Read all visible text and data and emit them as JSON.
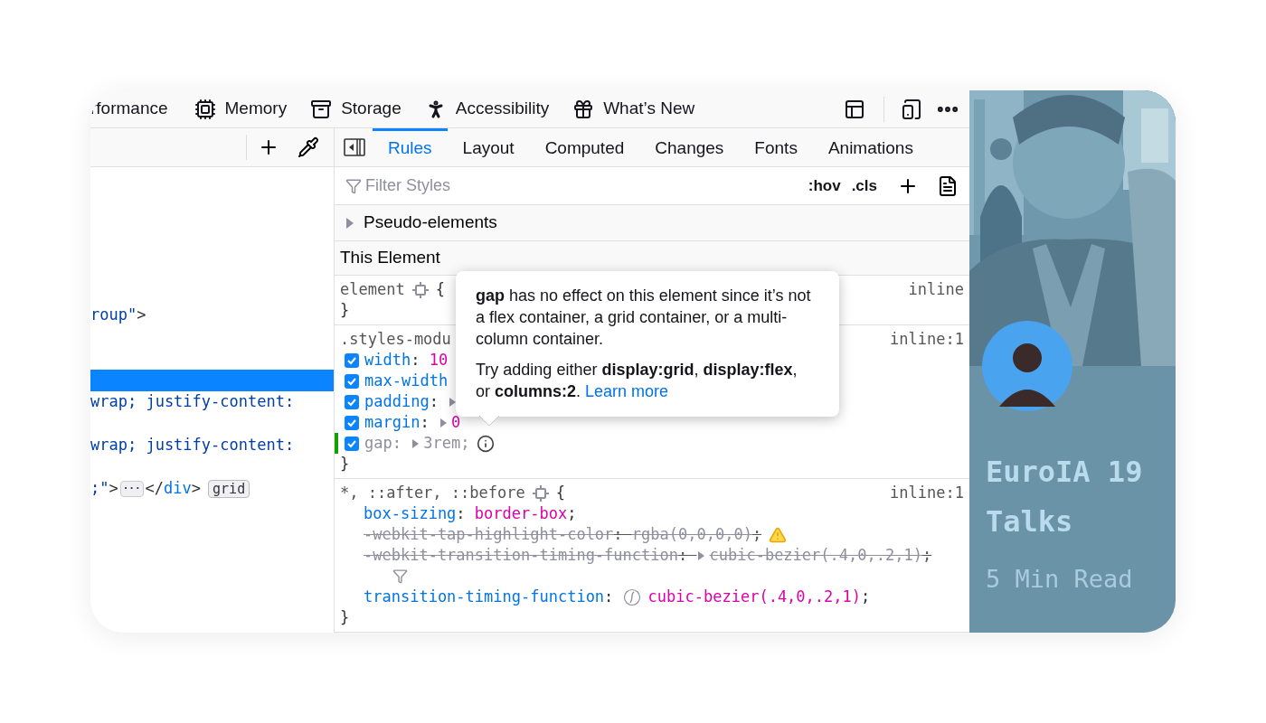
{
  "toolbar": {
    "tools": [
      {
        "label": "rformance"
      },
      {
        "label": "Memory"
      },
      {
        "label": "Storage"
      },
      {
        "label": "Accessibility"
      },
      {
        "label": "What’s New"
      }
    ]
  },
  "markup": {
    "lines": [
      {
        "selected": false
      },
      {
        "selected": false
      },
      {
        "selected": false
      },
      {
        "selected": false
      },
      {
        "selected": false
      },
      {
        "selected": false
      },
      {
        "selected": false,
        "segments": [
          {
            "text": "roup\"",
            "kind": "value"
          },
          {
            "text": ">",
            "kind": "punct"
          }
        ]
      },
      {
        "selected": false
      },
      {
        "selected": false
      },
      {
        "selected": true
      },
      {
        "selected": false,
        "segments": [
          {
            "text": "wrap; justify-content:",
            "kind": "value"
          }
        ]
      },
      {
        "selected": false
      },
      {
        "selected": false,
        "segments": [
          {
            "text": "wrap; justify-content:",
            "kind": "value"
          }
        ]
      },
      {
        "selected": false
      },
      {
        "selected": false,
        "segments": [
          {
            "text": ";\"",
            "kind": "value"
          },
          {
            "text": ">",
            "kind": "punct"
          },
          {
            "text": "···",
            "kind": "ellipsis"
          },
          {
            "text": "</",
            "kind": "punct"
          },
          {
            "text": "div",
            "kind": "tag"
          },
          {
            "text": ">",
            "kind": "punct"
          },
          {
            "text": "grid",
            "kind": "badge"
          }
        ]
      }
    ]
  },
  "rules_panel": {
    "tabs": [
      {
        "label": "Rules",
        "selected": true
      },
      {
        "label": "Layout",
        "selected": false
      },
      {
        "label": "Computed",
        "selected": false
      },
      {
        "label": "Changes",
        "selected": false
      },
      {
        "label": "Fonts",
        "selected": false
      },
      {
        "label": "Animations",
        "selected": false
      }
    ],
    "filter": {
      "placeholder": "Filter Styles"
    },
    "filter_buttons": [
      ":hov",
      ".cls"
    ],
    "pseudo_elements": {
      "label": "Pseudo-elements",
      "expanded": false
    },
    "section_title": "This Element",
    "rules": [
      {
        "selector": "element",
        "highlighter": true,
        "open": "{",
        "close": "}",
        "source": "inline"
      },
      {
        "selector": ".styles-modu",
        "highlighter": false,
        "close": "}",
        "source": "inline:1",
        "decls": [
          {
            "checked": true,
            "segments": [
              {
                "text": "width",
                "kind": "prop"
              },
              {
                "text": ": ",
                "kind": "punct"
              },
              {
                "text": "10",
                "kind": "value"
              }
            ]
          },
          {
            "checked": true,
            "segments": [
              {
                "text": "max-width",
                "kind": "prop"
              }
            ]
          },
          {
            "checked": true,
            "segments": [
              {
                "text": "padding",
                "kind": "prop"
              },
              {
                "text": ": ",
                "kind": "punct"
              },
              {
                "kind": "expander"
              }
            ]
          },
          {
            "checked": true,
            "segments": [
              {
                "text": "margin",
                "kind": "prop"
              },
              {
                "text": ": ",
                "kind": "punct"
              },
              {
                "kind": "expander"
              },
              {
                "text": "0",
                "kind": "value"
              }
            ]
          },
          {
            "checked": true,
            "changed": true,
            "segments": [
              {
                "text": "gap",
                "kind": "inactive"
              },
              {
                "text": ": ",
                "kind": "inactive"
              },
              {
                "kind": "expander"
              },
              {
                "text": "3rem;",
                "kind": "inactive"
              },
              {
                "kind": "info"
              }
            ]
          }
        ]
      },
      {
        "selector": "*, ::after, ::before",
        "highlighter": true,
        "open": "{",
        "close": "}",
        "source": "inline:1",
        "decls": [
          {
            "overridden": false,
            "segments": [
              {
                "text": "box-sizing",
                "kind": "prop"
              },
              {
                "text": ": ",
                "kind": "punct"
              },
              {
                "text": "border-box",
                "kind": "value"
              },
              {
                "text": ";",
                "kind": "punct"
              }
            ]
          },
          {
            "overridden": true,
            "segments": [
              {
                "text": "-webkit-tap-highlight-color",
                "kind": "prop"
              },
              {
                "text": ": ",
                "kind": "punct"
              },
              {
                "text": "rgba(0,0,0,0)",
                "kind": "value"
              },
              {
                "text": ";",
                "kind": "punct"
              },
              {
                "kind": "warning"
              }
            ]
          },
          {
            "overridden": true,
            "filtered": true,
            "segments": [
              {
                "text": "-webkit-transition-timing-function",
                "kind": "prop"
              },
              {
                "text": ": ",
                "kind": "punct"
              },
              {
                "kind": "expander"
              },
              {
                "text": "cubic-bezier(.4,0,.2,1)",
                "kind": "value"
              },
              {
                "text": ";",
                "kind": "punct"
              }
            ]
          },
          {
            "overridden": false,
            "segments": [
              {
                "text": "transition-timing-function",
                "kind": "prop"
              },
              {
                "text": ": ",
                "kind": "punct"
              },
              {
                "kind": "easing"
              },
              {
                "text": "cubic-bezier(.4,0,.2,1)",
                "kind": "value"
              },
              {
                "text": ";",
                "kind": "punct"
              }
            ]
          }
        ]
      }
    ],
    "tooltip": {
      "paragraphs": [
        "**gap** has no effect on this element since it’s not a flex container, a grid container, or a multi-column container.",
        "Try adding either **display:grid**, **display:flex**, or **columns:2**."
      ],
      "link": "Learn more"
    }
  },
  "card": {
    "title": "EuroIA 19 Talks",
    "meta": "5 Min Read"
  }
}
